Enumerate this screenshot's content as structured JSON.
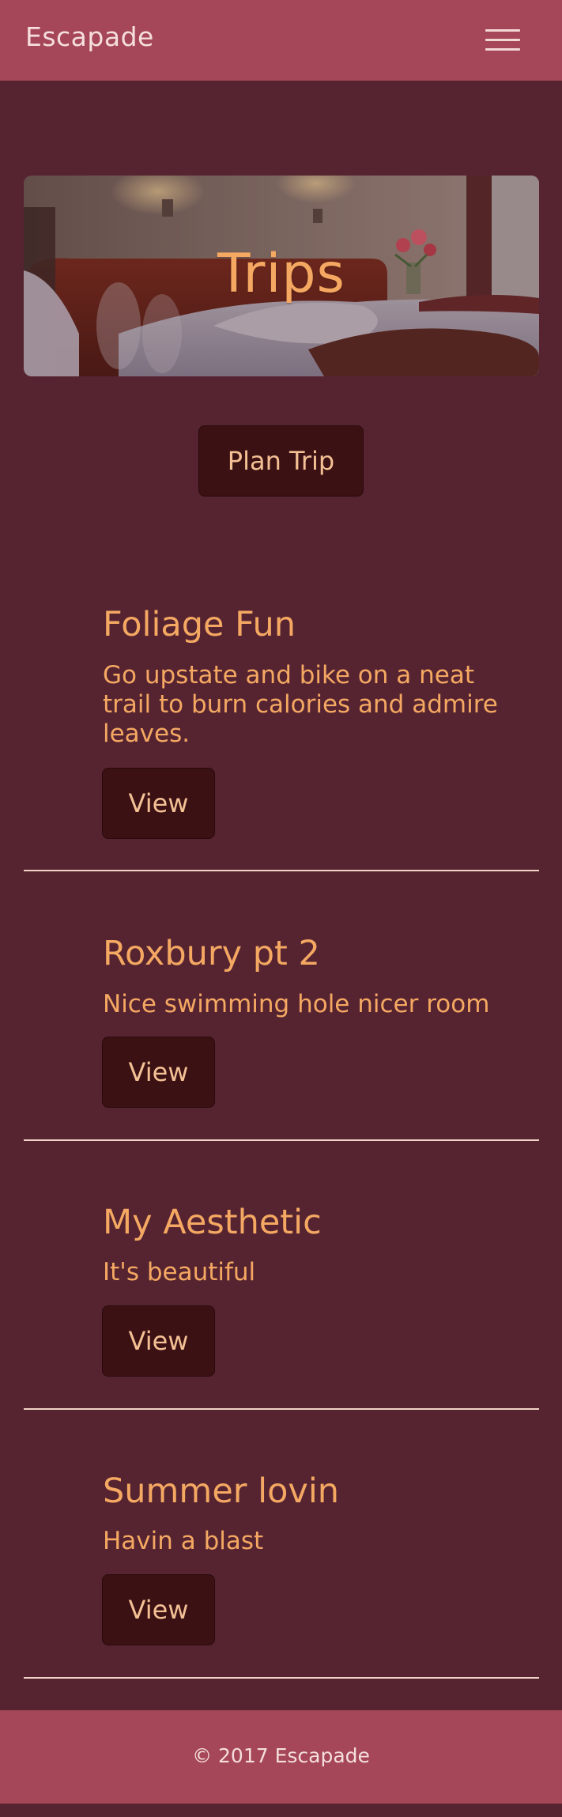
{
  "navbar": {
    "brand": "Escapade",
    "menu_icon": "hamburger-menu-icon"
  },
  "hero": {
    "title": "Trips"
  },
  "actions": {
    "plan_trip_label": "Plan Trip"
  },
  "trips": [
    {
      "title": "Foliage Fun",
      "description": "Go upstate and bike on a neat trail to burn calories and admire leaves.",
      "view_label": "View"
    },
    {
      "title": "Roxbury pt 2",
      "description": "Nice swimming hole nicer room",
      "view_label": "View"
    },
    {
      "title": "My Aesthetic",
      "description": "It's beautiful",
      "view_label": "View"
    },
    {
      "title": "Summer lovin",
      "description": "Havin a blast",
      "view_label": "View"
    }
  ],
  "footer": {
    "text": "© 2017 Escapade"
  },
  "colors": {
    "background": "#562431",
    "navbar": "#a54758",
    "accent_text": "#f4a862",
    "button_bg": "#3b1114",
    "button_text": "#f4c195"
  }
}
